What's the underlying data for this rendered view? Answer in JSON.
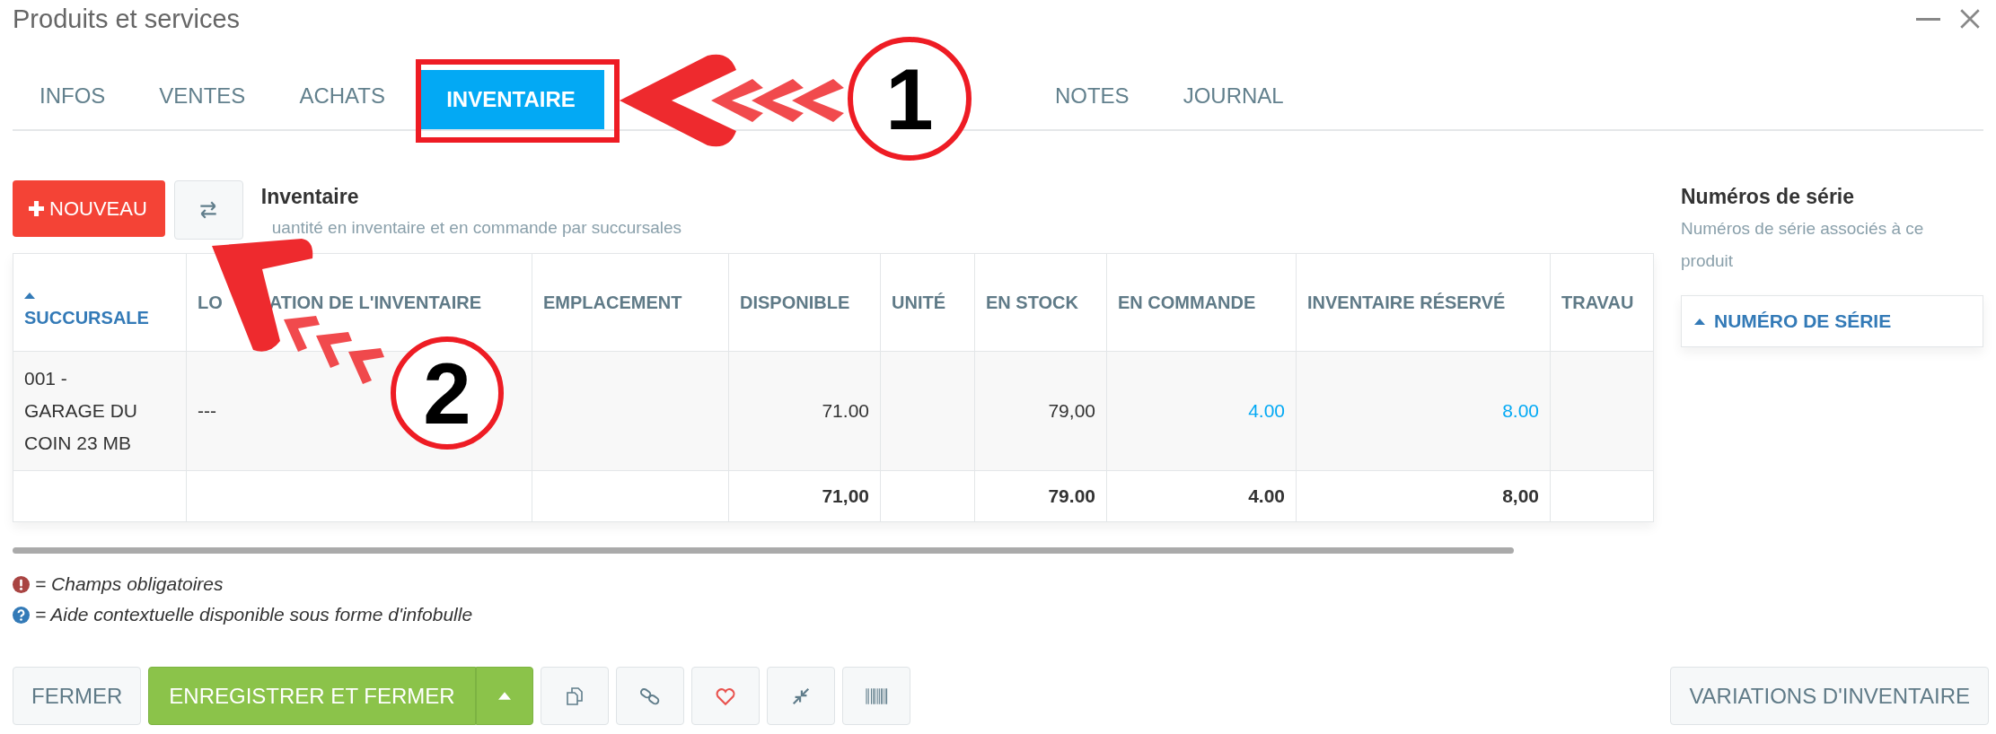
{
  "window": {
    "title": "Produits et services"
  },
  "tabs": [
    {
      "label": "INFOS",
      "selected": false
    },
    {
      "label": "VENTES",
      "selected": false
    },
    {
      "label": "ACHATS",
      "selected": false
    },
    {
      "label": "INVENTAIRE",
      "selected": true
    },
    {
      "label": "NOTES",
      "selected": false
    },
    {
      "label": "JOURNAL",
      "selected": false
    }
  ],
  "inventory": {
    "new_button": "NOUVEAU",
    "title": "Inventaire",
    "subtitle": "uantité en inventaire et en commande par succursales",
    "columns": [
      {
        "label": "SUCCURSALE",
        "sorted": true
      },
      {
        "label": "LO",
        "label_end": "ATION DE L'INVENTAIRE",
        "sorted": false
      },
      {
        "label": "EMPLACEMENT",
        "sorted": false
      },
      {
        "label": "DISPONIBLE",
        "sorted": false
      },
      {
        "label": "UNITÉ",
        "sorted": false
      },
      {
        "label": "EN STOCK",
        "sorted": false
      },
      {
        "label": "EN COMMANDE",
        "sorted": false
      },
      {
        "label": "INVENTAIRE RÉSERVÉ",
        "sorted": false
      },
      {
        "label": "TRAVAU",
        "sorted": false
      }
    ],
    "rows": [
      {
        "kind": "data",
        "cells": [
          {
            "text": "001 - GARAGE DU COIN 23 MB",
            "kind": "plain"
          },
          {
            "text": "---",
            "kind": "plain"
          },
          null,
          {
            "text": "71.00",
            "kind": "plain"
          },
          null,
          {
            "text": "79,00",
            "kind": "plain"
          },
          {
            "text": "4.00",
            "kind": "link"
          },
          {
            "text": "8.00",
            "kind": "link"
          },
          null
        ]
      },
      {
        "kind": "total",
        "cells": [
          null,
          null,
          null,
          {
            "text": "71,00",
            "kind": "plain"
          },
          null,
          {
            "text": "79.00",
            "kind": "plain"
          },
          {
            "text": "4.00",
            "kind": "plain"
          },
          {
            "text": "8,00",
            "kind": "plain"
          },
          null
        ]
      }
    ]
  },
  "serials": {
    "title": "Numéros de série",
    "subtitle": "Numéros de série associés à ce produit",
    "column": "NUMÉRO DE SÉRIE"
  },
  "legend": [
    {
      "kind": "required",
      "text": "= Champs obligatoires"
    },
    {
      "kind": "help",
      "text": "= Aide contextuelle disponible sous forme d'infobulle"
    }
  ],
  "footer": {
    "close": "FERMER",
    "save": "ENREGISTRER ET FERMER",
    "tools": [
      {
        "kind": "copy"
      },
      {
        "kind": "link"
      },
      {
        "kind": "heart"
      },
      {
        "kind": "collapse"
      },
      {
        "kind": "barcode"
      }
    ],
    "variations": "VARIATIONS D'INVENTAIRE"
  },
  "annotations": [
    {
      "number": "1"
    },
    {
      "number": "2"
    }
  ]
}
